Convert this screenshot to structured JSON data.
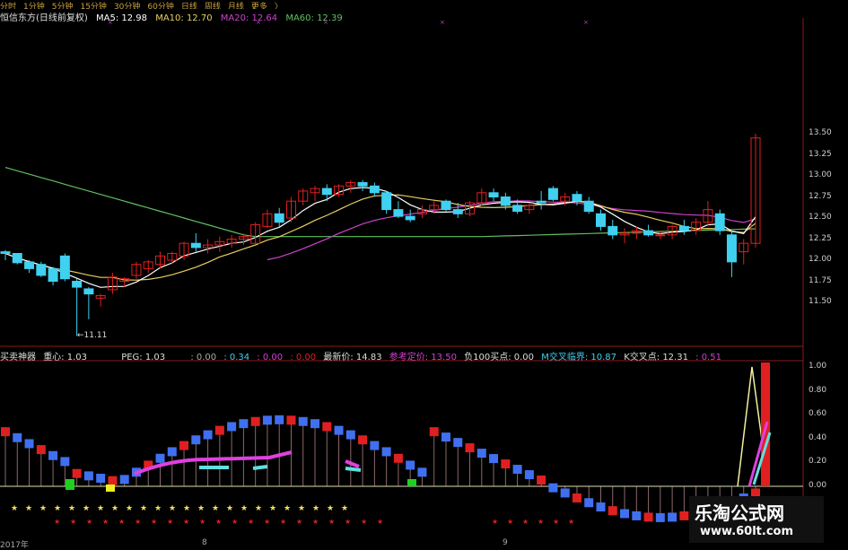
{
  "tabs": [
    "分时",
    "1分钟",
    "5分钟",
    "15分钟",
    "30分钟",
    "60分钟",
    "日线",
    "周线",
    "月线",
    "更多",
    "〉"
  ],
  "main_header": {
    "stock": "恒信东方(日线前复权)",
    "ma5": "MA5: 12.98",
    "ma10": "MA10: 12.70",
    "ma20": "MA20: 12.64",
    "ma60": "MA60: 12.39"
  },
  "price_axis": [
    "13.50",
    "13.25",
    "13.00",
    "12.75",
    "12.50",
    "12.25",
    "12.00",
    "11.75",
    "11.50"
  ],
  "low_marker": "11.11",
  "indicator_header": {
    "name": "买卖神器",
    "center": "重心: 1.03",
    "peg": "PEG: 1.03",
    "v1": ": 0.00",
    "v2": ": 0.34",
    "v3": ": 0.00",
    "v4": ": 0.00",
    "latest": "最新价: 14.83",
    "ref": "参考定价: 13.50",
    "buy100": "负100买点: 0.00",
    "mcross": "M交叉临界: 10.87",
    "kcross": "K交叉点: 12.31",
    "v5": ": 0.51"
  },
  "ind_axis": [
    "1.00",
    "0.80",
    "0.60",
    "0.40",
    "0.20",
    "0.00"
  ],
  "date_labels": [
    "2017年",
    "8",
    "9"
  ],
  "watermark": {
    "cn": "乐淘公式网",
    "url": "www.60lt.com"
  },
  "colors": {
    "up": "#e02020",
    "down": "#40d0f0",
    "ma5": "#ffffff",
    "ma10": "#e8d060",
    "ma20": "#d040d0",
    "ma60": "#60c060",
    "tab": "#c8a040"
  },
  "chart_data": {
    "type": "candlestick",
    "title": "恒信东方(日线前复权)",
    "y_range": [
      11.1,
      13.55
    ],
    "ohlc_index": [
      0,
      1,
      2,
      3,
      4,
      5,
      6,
      7,
      8,
      9,
      10,
      11,
      12,
      13,
      14,
      15,
      16,
      17,
      18,
      19,
      20,
      21,
      22,
      23,
      24,
      25,
      26,
      27,
      28,
      29,
      30,
      31,
      32,
      33,
      34,
      35,
      36,
      37,
      38,
      39,
      40,
      41,
      42,
      43,
      44,
      45,
      46,
      47,
      48,
      49,
      50,
      51,
      52,
      53,
      54,
      55,
      56,
      57,
      58,
      59,
      60,
      61,
      62,
      63,
      64,
      65,
      66
    ],
    "candles": [
      [
        12.1,
        12.12,
        12.0,
        12.08
      ],
      [
        12.08,
        12.05,
        11.95,
        11.97
      ],
      [
        11.98,
        12.0,
        11.85,
        11.9
      ],
      [
        11.95,
        11.98,
        11.8,
        11.82
      ],
      [
        11.9,
        11.92,
        11.7,
        11.75
      ],
      [
        12.05,
        12.08,
        11.75,
        11.78
      ],
      [
        11.75,
        11.78,
        11.1,
        11.68
      ],
      [
        11.66,
        11.68,
        11.3,
        11.6
      ],
      [
        11.55,
        11.6,
        11.45,
        11.58
      ],
      [
        11.65,
        11.85,
        11.6,
        11.8
      ],
      [
        11.75,
        11.8,
        11.68,
        11.78
      ],
      [
        11.82,
        11.98,
        11.78,
        11.95
      ],
      [
        11.9,
        12.0,
        11.85,
        11.98
      ],
      [
        11.95,
        12.1,
        11.9,
        12.05
      ],
      [
        12.0,
        12.1,
        11.95,
        12.08
      ],
      [
        12.05,
        12.22,
        12.0,
        12.2
      ],
      [
        12.2,
        12.32,
        12.1,
        12.15
      ],
      [
        12.15,
        12.25,
        12.08,
        12.18
      ],
      [
        12.18,
        12.28,
        12.1,
        12.22
      ],
      [
        12.2,
        12.3,
        12.15,
        12.25
      ],
      [
        12.25,
        12.32,
        12.18,
        12.28
      ],
      [
        12.2,
        12.45,
        12.2,
        12.42
      ],
      [
        12.4,
        12.6,
        12.38,
        12.55
      ],
      [
        12.55,
        12.62,
        12.4,
        12.45
      ],
      [
        12.5,
        12.75,
        12.45,
        12.7
      ],
      [
        12.7,
        12.85,
        12.65,
        12.82
      ],
      [
        12.8,
        12.88,
        12.7,
        12.85
      ],
      [
        12.85,
        12.9,
        12.7,
        12.78
      ],
      [
        12.78,
        12.9,
        12.75,
        12.88
      ],
      [
        12.88,
        12.95,
        12.8,
        12.92
      ],
      [
        12.92,
        12.95,
        12.82,
        12.88
      ],
      [
        12.88,
        12.92,
        12.75,
        12.8
      ],
      [
        12.8,
        12.82,
        12.55,
        12.6
      ],
      [
        12.6,
        12.7,
        12.5,
        12.52
      ],
      [
        12.52,
        12.6,
        12.45,
        12.48
      ],
      [
        12.55,
        12.65,
        12.5,
        12.6
      ],
      [
        12.6,
        12.7,
        12.55,
        12.65
      ],
      [
        12.7,
        12.72,
        12.58,
        12.6
      ],
      [
        12.6,
        12.68,
        12.5,
        12.55
      ],
      [
        12.55,
        12.7,
        12.52,
        12.68
      ],
      [
        12.68,
        12.85,
        12.65,
        12.8
      ],
      [
        12.8,
        12.85,
        12.7,
        12.75
      ],
      [
        12.75,
        12.8,
        12.6,
        12.65
      ],
      [
        12.65,
        12.72,
        12.55,
        12.58
      ],
      [
        12.6,
        12.68,
        12.55,
        12.65
      ],
      [
        12.7,
        12.82,
        12.6,
        12.68
      ],
      [
        12.85,
        12.88,
        12.7,
        12.72
      ],
      [
        12.7,
        12.8,
        12.65,
        12.75
      ],
      [
        12.78,
        12.82,
        12.65,
        12.7
      ],
      [
        12.7,
        12.75,
        12.55,
        12.58
      ],
      [
        12.55,
        12.6,
        12.35,
        12.4
      ],
      [
        12.4,
        12.48,
        12.25,
        12.3
      ],
      [
        12.3,
        12.38,
        12.2,
        12.32
      ],
      [
        12.32,
        12.4,
        12.25,
        12.35
      ],
      [
        12.35,
        12.42,
        12.28,
        12.3
      ],
      [
        12.3,
        12.35,
        12.25,
        12.3
      ],
      [
        12.3,
        12.42,
        12.25,
        12.4
      ],
      [
        12.4,
        12.48,
        12.3,
        12.35
      ],
      [
        12.35,
        12.5,
        12.3,
        12.45
      ],
      [
        12.45,
        12.7,
        12.4,
        12.6
      ],
      [
        12.55,
        12.6,
        12.3,
        12.35
      ],
      [
        12.3,
        12.35,
        11.8,
        11.98
      ],
      [
        12.1,
        12.25,
        11.95,
        12.2
      ],
      [
        12.2,
        13.5,
        12.15,
        13.45
      ]
    ],
    "series": [
      {
        "name": "MA5"
      },
      {
        "name": "MA10"
      },
      {
        "name": "MA20"
      },
      {
        "name": "MA60"
      }
    ]
  }
}
